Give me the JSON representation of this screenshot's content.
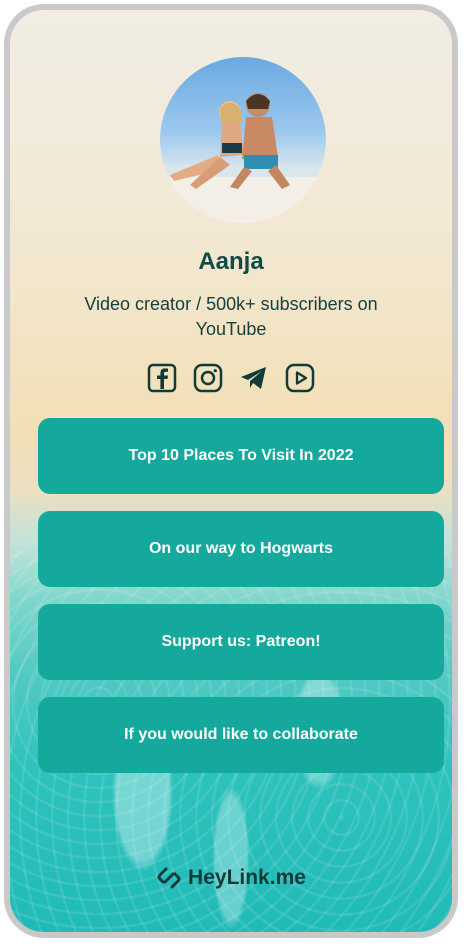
{
  "profile": {
    "name": "Aanja",
    "bio": "Video creator /  500k+ subscribers on YouTube",
    "avatar_icon": "couple-beach-photo"
  },
  "socials": [
    {
      "icon": "facebook-icon"
    },
    {
      "icon": "instagram-icon"
    },
    {
      "icon": "telegram-icon"
    },
    {
      "icon": "youtube-icon"
    }
  ],
  "links": [
    {
      "label": "Top 10 Places To Visit In 2022"
    },
    {
      "label": "On our way to Hogwarts"
    },
    {
      "label": "Support us: Patreon!"
    },
    {
      "label": "If you would like to collaborate"
    }
  ],
  "brand": {
    "label": "HeyLink.me",
    "icon": "heylink-logo-icon"
  },
  "colors": {
    "accent": "#14a99c",
    "text_dark": "#0f4b47"
  }
}
